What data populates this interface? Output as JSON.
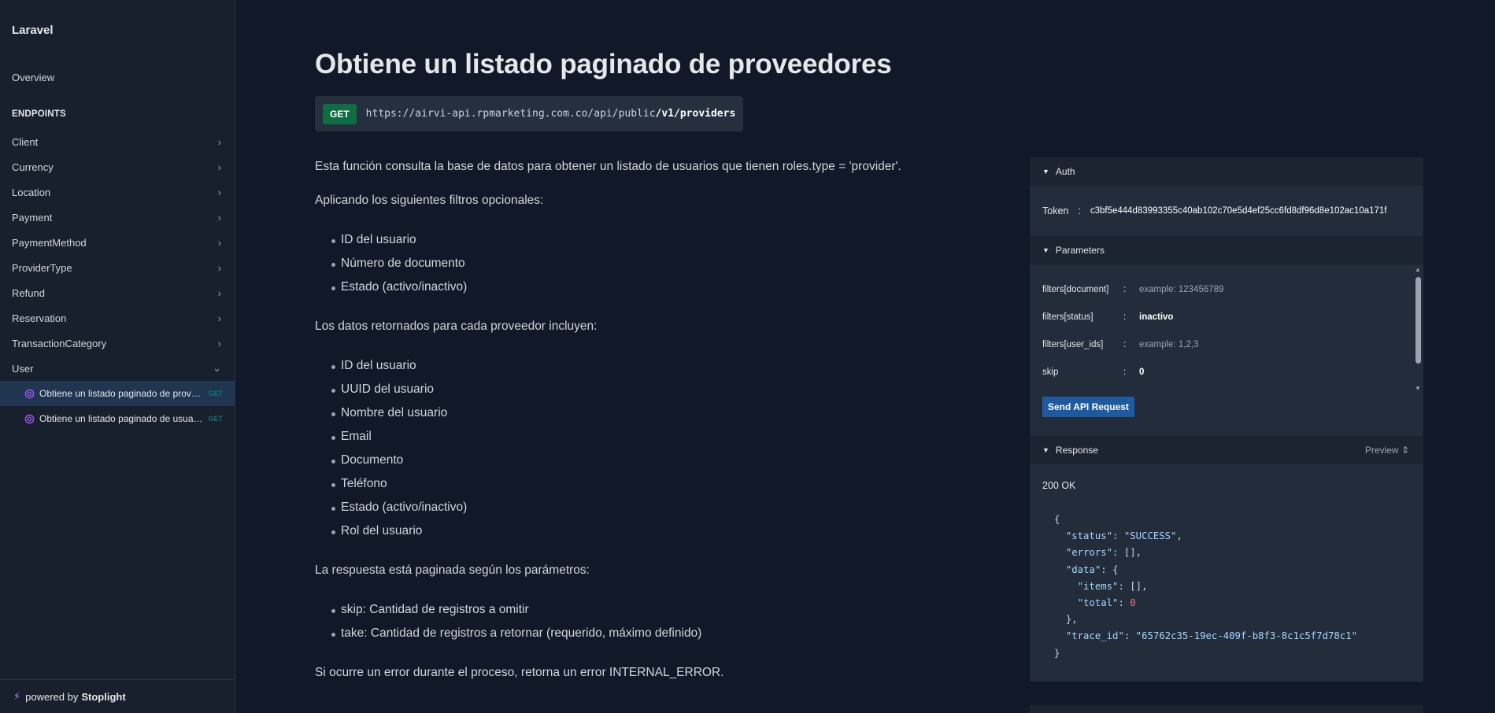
{
  "sidebar": {
    "brand": "Laravel",
    "overview": "Overview",
    "section_title": "ENDPOINTS",
    "groups": [
      {
        "label": "Client"
      },
      {
        "label": "Currency"
      },
      {
        "label": "Location"
      },
      {
        "label": "Payment"
      },
      {
        "label": "PaymentMethod"
      },
      {
        "label": "ProviderType"
      },
      {
        "label": "Refund"
      },
      {
        "label": "Reservation"
      },
      {
        "label": "TransactionCategory"
      },
      {
        "label": "User"
      }
    ],
    "user_endpoints": [
      {
        "label": "Obtiene un listado paginado de proveedores",
        "method": "GET",
        "active": true
      },
      {
        "label": "Obtiene un listado paginado de usuarios",
        "method": "GET",
        "active": false
      }
    ],
    "powered_prefix": "powered by",
    "powered_brand": "Stoplight"
  },
  "main": {
    "title": "Obtiene un listado paginado de proveedores",
    "method": "GET",
    "url_base": "https://airvi-api.rpmarketing.com.co/api/public",
    "url_path": "/v1/providers",
    "intro": "Esta función consulta la base de datos para obtener un listado de usuarios que tienen roles.type = 'provider'.",
    "filters_intro": "Aplicando los siguientes filtros opcionales:",
    "filters": [
      "ID del usuario",
      "Número de documento",
      "Estado (activo/inactivo)"
    ],
    "fields_intro": "Los datos retornados para cada proveedor incluyen:",
    "fields": [
      "ID del usuario",
      "UUID del usuario",
      "Nombre del usuario",
      "Email",
      "Documento",
      "Teléfono",
      "Estado (activo/inactivo)",
      "Rol del usuario"
    ],
    "pagination_intro": "La respuesta está paginada según los parámetros:",
    "pagination": [
      "skip: Cantidad de registros a omitir",
      "take: Cantidad de registros a retornar (requerido, máximo definido)"
    ],
    "error_note": "Si ocurre un error durante el proceso, retorna un error INTERNAL_ERROR."
  },
  "panel": {
    "auth_label": "Auth",
    "token_label": "Token",
    "token_value": "c3bf5e444d83993355c40ab102c70e5d4ef25cc6fd8df96d8e102ac10a171f",
    "params_label": "Parameters",
    "params": [
      {
        "name": "filters[document]",
        "placeholder": "example: 123456789",
        "value": ""
      },
      {
        "name": "filters[status]",
        "placeholder": "",
        "value": "inactivo"
      },
      {
        "name": "filters[user_ids]",
        "placeholder": "example: 1,2,3",
        "value": ""
      },
      {
        "name": "skip",
        "placeholder": "",
        "value": "0"
      }
    ],
    "send_label": "Send API Request",
    "response_label": "Response",
    "preview_label": "Preview",
    "status_line": "200 OK",
    "response_json": {
      "status": "SUCCESS",
      "errors": "[]",
      "items": "[]",
      "total": "0",
      "trace_id": "65762c35-19ec-409f-b8f3-8c1c5f7d78c1"
    }
  }
}
